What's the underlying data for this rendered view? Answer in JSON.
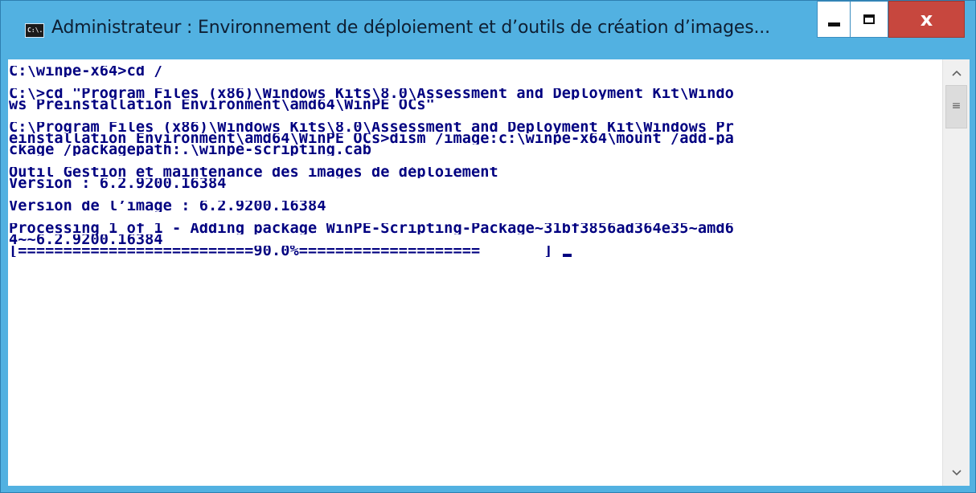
{
  "window": {
    "title": "Administrateur : Environnement de déploiement et d’outils de création d’images...",
    "icon_label": "C:\\."
  },
  "caption_buttons": {
    "minimize_icon": "minimize-icon",
    "maximize_icon": "maximize-icon",
    "close_glyph": "x"
  },
  "console": {
    "lines": [
      "C:\\winpe-x64>cd /",
      "",
      "C:\\>cd \"Program Files (x86)\\Windows Kits\\8.0\\Assessment and Deployment Kit\\Windo",
      "ws Preinstallation Environment\\amd64\\WinPE_OCs\"",
      "",
      "C:\\Program Files (x86)\\Windows Kits\\8.0\\Assessment and Deployment Kit\\Windows Pr",
      "einstallation Environment\\amd64\\WinPE_OCs>dism /image:c:\\winpe-x64\\mount /add-pa",
      "ckage /packagepath:.\\winpe-scripting.cab",
      "",
      "Outil Gestion et maintenance des images de déploiement",
      "Version : 6.2.9200.16384",
      "",
      "Version de l’image : 6.2.9200.16384",
      "",
      "Processing 1 of 1 - Adding package WinPE-Scripting-Package~31bf3856ad364e35~amd6",
      "4~~6.2.9200.16384",
      "[==========================90.0%====================       ] "
    ],
    "progress_percent": 90.0
  },
  "scrollbar": {
    "up_arrow": "^",
    "down_arrow": "v",
    "thumb_grip": "≡"
  },
  "colors": {
    "frame": "#52b1e1",
    "console_text": "#000080",
    "console_background": "#ffffff",
    "close_button": "#c7473e"
  }
}
